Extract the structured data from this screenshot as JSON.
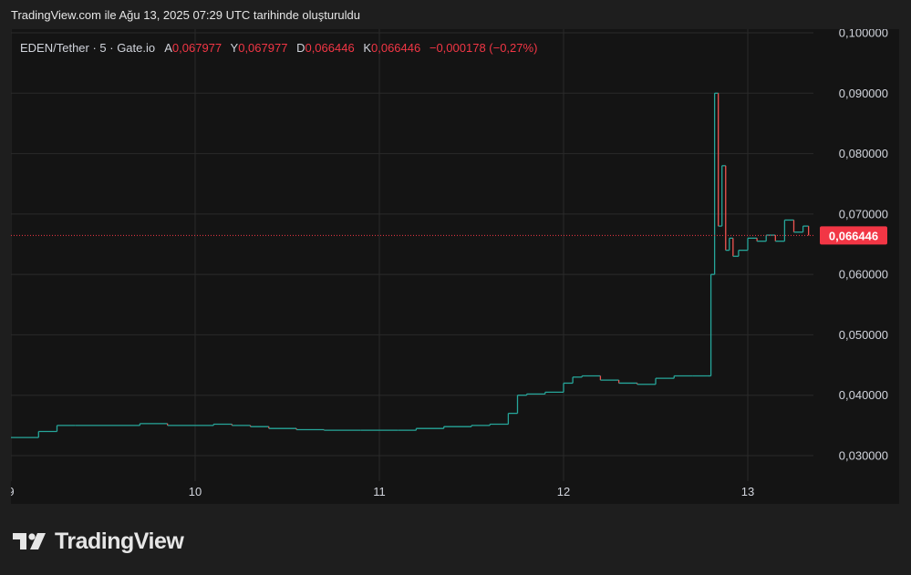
{
  "header": {
    "caption": "TradingView.com ile Ağu 13, 2025 07:29 UTC tarihinde oluşturuldu"
  },
  "legend": {
    "symbol": "EDEN/Tether · 5 · Gate.io",
    "o_key": "A",
    "o_val": "0,067977",
    "h_key": "Y",
    "h_val": "0,067977",
    "l_key": "D",
    "l_val": "0,066446",
    "c_key": "K",
    "c_val": "0,066446",
    "change": "−0,000178 (−0,27%)"
  },
  "footer": {
    "brand": "TradingView"
  },
  "colors": {
    "up": "#26a69a",
    "down": "#ef5350",
    "price_line": "#f23645",
    "background": "#141414",
    "grid": "#2a2a2a"
  },
  "chart_data": {
    "type": "line",
    "yticks": [
      "0,030000",
      "0,040000",
      "0,050000",
      "0,060000",
      "0,070000",
      "0,080000",
      "0,090000",
      "0,100000"
    ],
    "xticks": [
      "9",
      "10",
      "11",
      "12",
      "13"
    ],
    "last_price_label": "0,066446",
    "ylim": [
      0.03,
      0.1
    ],
    "x_label_positions": [
      9,
      10,
      11,
      12,
      13
    ],
    "series": [
      {
        "x": [
          9.0,
          9.15,
          9.25,
          9.35,
          9.5,
          9.7,
          9.85,
          10.0,
          10.1,
          10.2,
          10.3,
          10.4,
          10.55,
          10.7,
          10.9,
          11.0,
          11.1,
          11.2,
          11.35,
          11.5,
          11.6,
          11.7,
          11.75,
          11.8,
          11.9,
          12.0,
          12.05,
          12.1,
          12.2,
          12.3,
          12.4,
          12.5,
          12.6,
          12.7,
          12.78,
          12.8,
          12.82,
          12.84,
          12.86,
          12.88,
          12.9,
          12.92,
          12.95,
          13.0,
          13.05,
          13.1,
          13.15,
          13.2,
          13.25,
          13.3,
          13.33
        ],
        "y": [
          0.033,
          0.034,
          0.035,
          0.035,
          0.035,
          0.0353,
          0.035,
          0.035,
          0.0352,
          0.035,
          0.0348,
          0.0345,
          0.0343,
          0.0342,
          0.0342,
          0.0342,
          0.0342,
          0.0345,
          0.0348,
          0.035,
          0.0352,
          0.037,
          0.04,
          0.0402,
          0.0405,
          0.042,
          0.043,
          0.0432,
          0.0425,
          0.042,
          0.0418,
          0.0428,
          0.0432,
          0.0432,
          0.0432,
          0.06,
          0.09,
          0.068,
          0.078,
          0.064,
          0.066,
          0.063,
          0.064,
          0.066,
          0.0655,
          0.0665,
          0.0655,
          0.069,
          0.067,
          0.068,
          0.066446
        ]
      }
    ]
  }
}
